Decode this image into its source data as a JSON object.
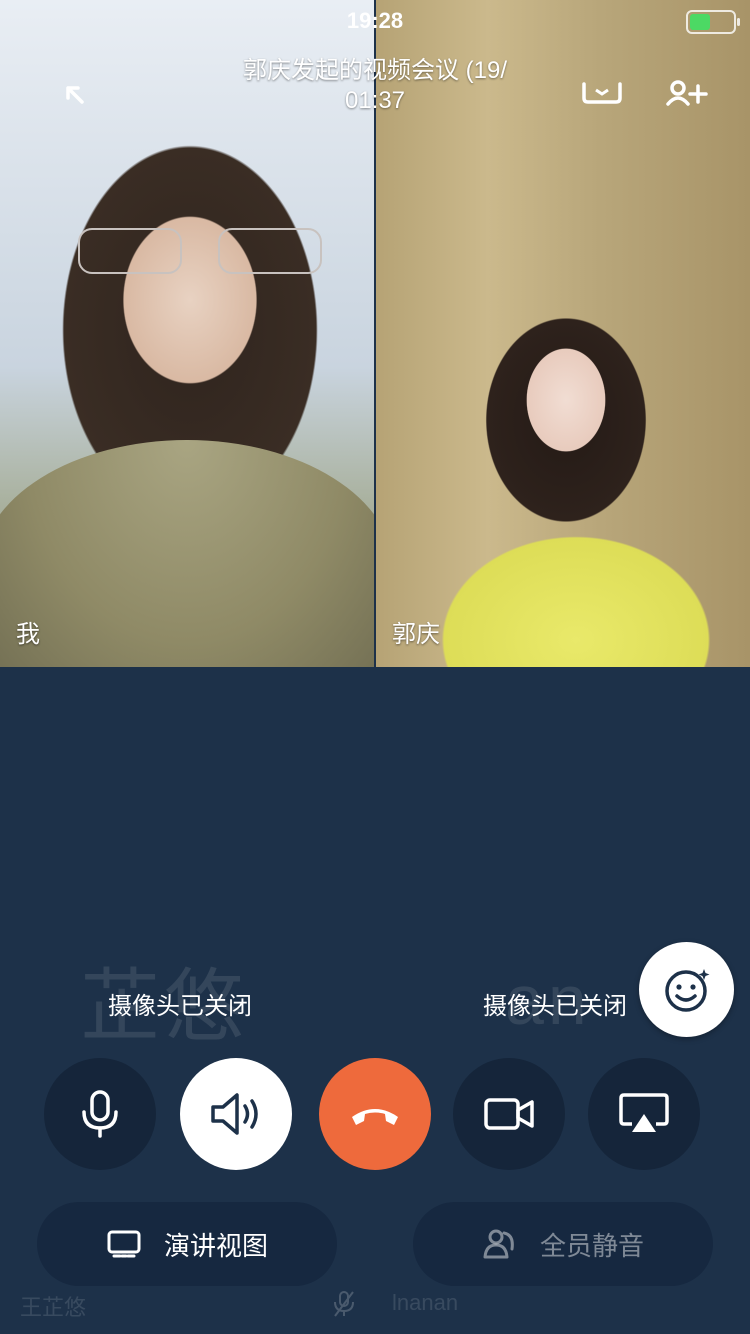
{
  "status_bar": {
    "time": "19:28",
    "battery_icon": "battery-charging-icon"
  },
  "header": {
    "title": "郭庆发起的视频会议 (19/",
    "timer": "01:37",
    "icons": [
      "minimize-icon",
      "camera-switch-icon",
      "add-member-icon"
    ]
  },
  "tiles": [
    {
      "label": "我"
    },
    {
      "label": "郭庆"
    }
  ],
  "audio_tiles": {
    "left": {
      "watermark": "芷悠",
      "status": "摄像头已关闭",
      "name": "王芷悠"
    },
    "right": {
      "watermark": "an",
      "status": "摄像头已关闭",
      "name": "lnanan"
    }
  },
  "controls": {
    "beauty": "face-smile-icon",
    "mic": "microphone-icon",
    "speaker": "speaker-icon",
    "hangup": "phone-hangup-icon",
    "video": "video-camera-icon",
    "share": "screen-share-icon"
  },
  "bottom_buttons": {
    "presentation_view": "演讲视图",
    "mute_all": "全员静音"
  },
  "colors": {
    "background": "#1d3149",
    "hangup": "#ee6a3c",
    "button_dark": "#15253a",
    "battery": "#4cd964"
  }
}
